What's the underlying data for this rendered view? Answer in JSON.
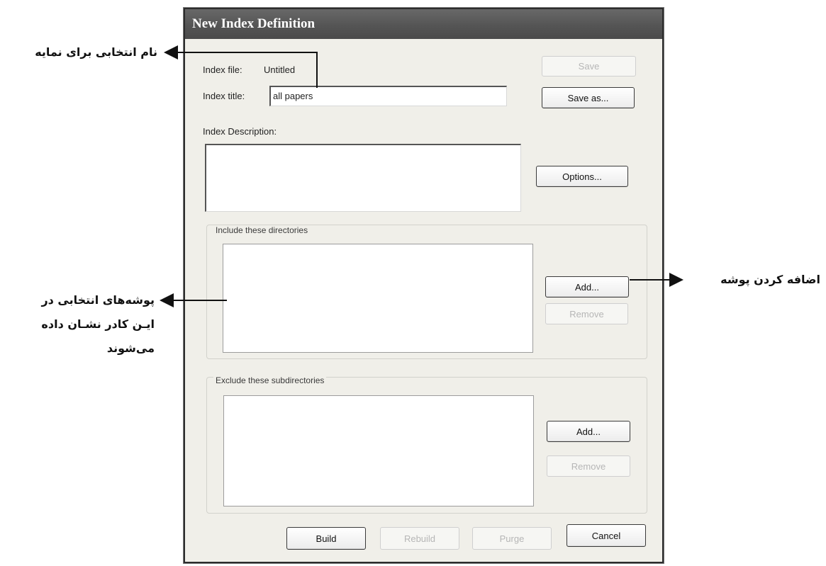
{
  "dialog": {
    "title": "New Index Definition",
    "index_file_label": "Index file:",
    "index_file_value": "Untitled",
    "index_title_label": "Index title:",
    "index_title_value": "all papers",
    "index_description_label": "Index Description:",
    "include_group_label": "Include these directories",
    "exclude_group_label": "Exclude these subdirectories",
    "buttons": {
      "save": "Save",
      "save_as": "Save as...",
      "options": "Options...",
      "include_add": "Add...",
      "include_remove": "Remove",
      "exclude_add": "Add...",
      "exclude_remove": "Remove",
      "build": "Build",
      "rebuild": "Rebuild",
      "purge": "Purge",
      "cancel": "Cancel"
    }
  },
  "annotations": {
    "title_note": "نام انتخابی برای نمایه",
    "add_note": "اضافه کردن پوشه",
    "folders_note_line1": "پوشه‌های انتخابی در",
    "folders_note_line2": "ایـن کادر نشـان داده",
    "folders_note_line3": "می‌شوند"
  }
}
